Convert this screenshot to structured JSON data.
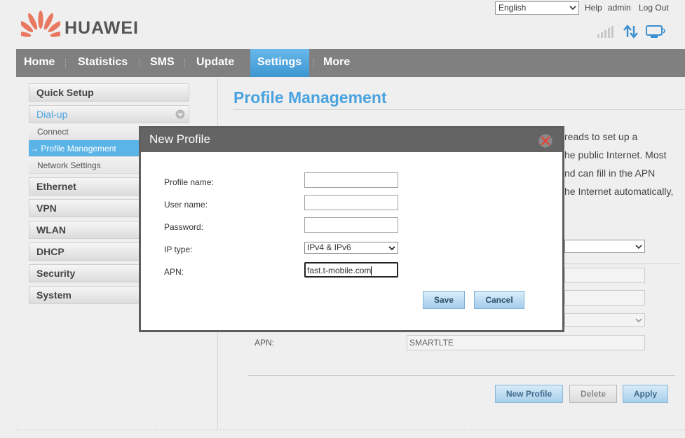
{
  "header": {
    "brand": "HUAWEI",
    "language": "English",
    "help_label": "Help",
    "user": "admin",
    "logout_label": "Log Out"
  },
  "nav": {
    "items": [
      {
        "label": "Home"
      },
      {
        "label": "Statistics"
      },
      {
        "label": "SMS"
      },
      {
        "label": "Update"
      },
      {
        "label": "Settings",
        "active": true
      },
      {
        "label": "More"
      }
    ]
  },
  "sidebar": {
    "quick_setup": "Quick Setup",
    "dialup": "Dial-up",
    "dialup_sub": [
      "Connect",
      "Profile Management",
      "Network Settings"
    ],
    "active_sub_prefix": "→",
    "ethernet": "Ethernet",
    "vpn": "VPN",
    "wlan": "WLAN",
    "dhcp": "DHCP",
    "security": "Security",
    "system": "System"
  },
  "main": {
    "title": "Profile Management",
    "desc_fragments": [
      "reads to set up a",
      "he public Internet. Most",
      "nd can fill in the APN",
      "he Internet automatically,"
    ],
    "apn_label": "APN:",
    "apn_value": "SMARTLTE",
    "buttons": {
      "new_profile": "New Profile",
      "delete": "Delete",
      "apply": "Apply"
    }
  },
  "modal": {
    "title": "New Profile",
    "fields": {
      "profile_name_label": "Profile name:",
      "profile_name_value": "",
      "user_name_label": "User name:",
      "user_name_value": "",
      "password_label": "Password:",
      "password_value": "",
      "ip_type_label": "IP type:",
      "ip_type_value": "IPv4 & IPv6",
      "apn_label": "APN:",
      "apn_value": "fast.t-mobile.com"
    },
    "save_label": "Save",
    "cancel_label": "Cancel"
  },
  "colors": {
    "accent": "#4aa3df",
    "nav_bg": "#808080",
    "nav_active": "#5bb4e8",
    "logo_red": "#e0463b"
  }
}
